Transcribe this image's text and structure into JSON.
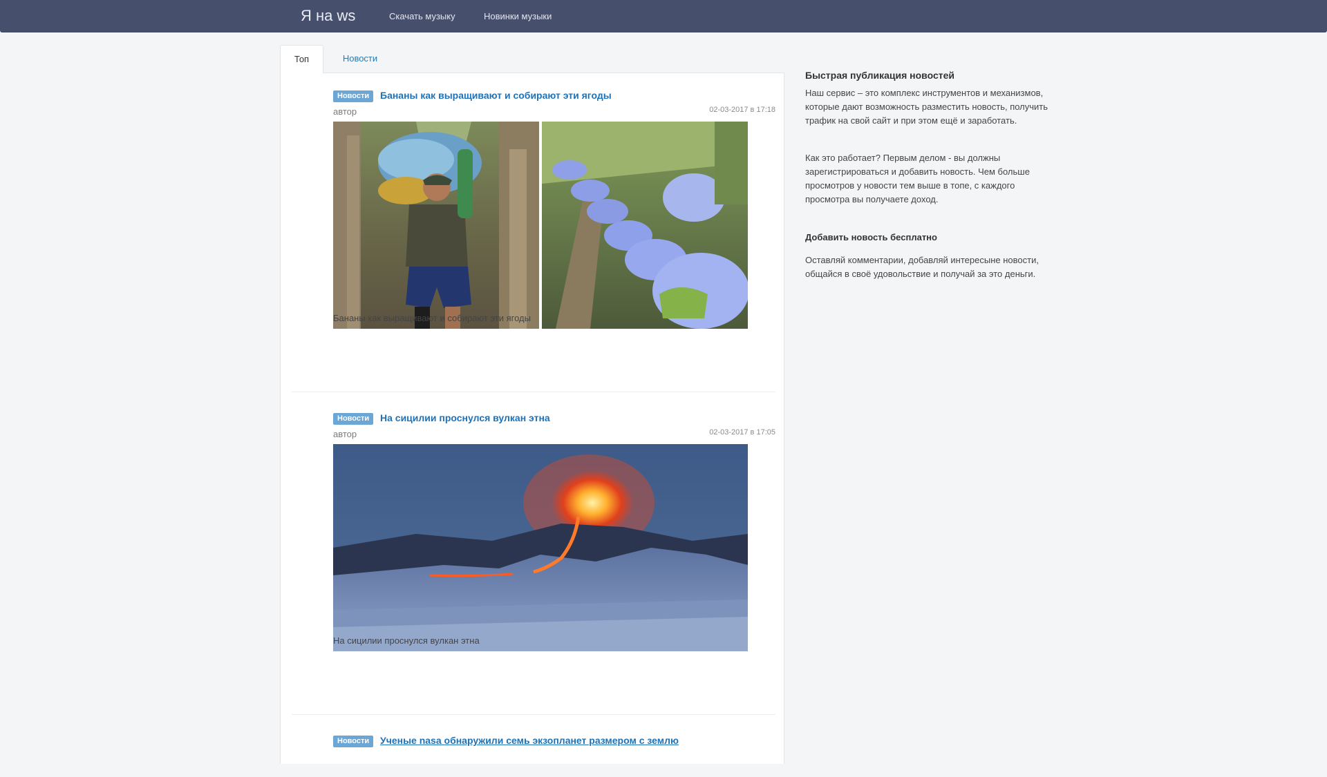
{
  "navbar": {
    "brand": "Я на ws",
    "links": [
      "Скачать музыку",
      "Новинки музыки"
    ]
  },
  "tabs": [
    {
      "label": "Топ",
      "active": true
    },
    {
      "label": "Новости",
      "active": false
    }
  ],
  "posts": [
    {
      "category": "Новости",
      "title": "Бананы как выращивают и собирают эти ягоды",
      "author": "автор",
      "date": "02-03-2017 в 17:18",
      "text": "Бананы как выращивают и собирают эти ягоды"
    },
    {
      "category": "Новости",
      "title": "На сицилии проснулся вулкан этна",
      "author": "автор",
      "date": "02-03-2017 в 17:05",
      "text": "На сицилии проснулся вулкан этна"
    },
    {
      "category": "Новости",
      "title": "Ученые nasa обнаружили семь экзопланет размером с землю"
    }
  ],
  "sidebar": {
    "heading": "Быстрая публикация новостей",
    "para1": "Наш сервис – это комплекс инструментов и механизмов, которые дают возможность разместить новость, получить трафик на свой сайт и при этом ещё и заработать.",
    "para2": "Как это работает? Первым делом - вы должны зарегистрироваться и добавить новость. Чем больше просмотров у новости тем выше в топе, с каждого просмотра вы получаете доход.",
    "add_heading": "Добавить новость бесплатно",
    "para3": "Оставляй комментарии, добавляй интересыне новости, общайся в своё удовольствие и получай за это деньги."
  },
  "colors": {
    "navbar": "#46506d",
    "badge": "#6aa7d6",
    "link": "#1d72b8"
  }
}
